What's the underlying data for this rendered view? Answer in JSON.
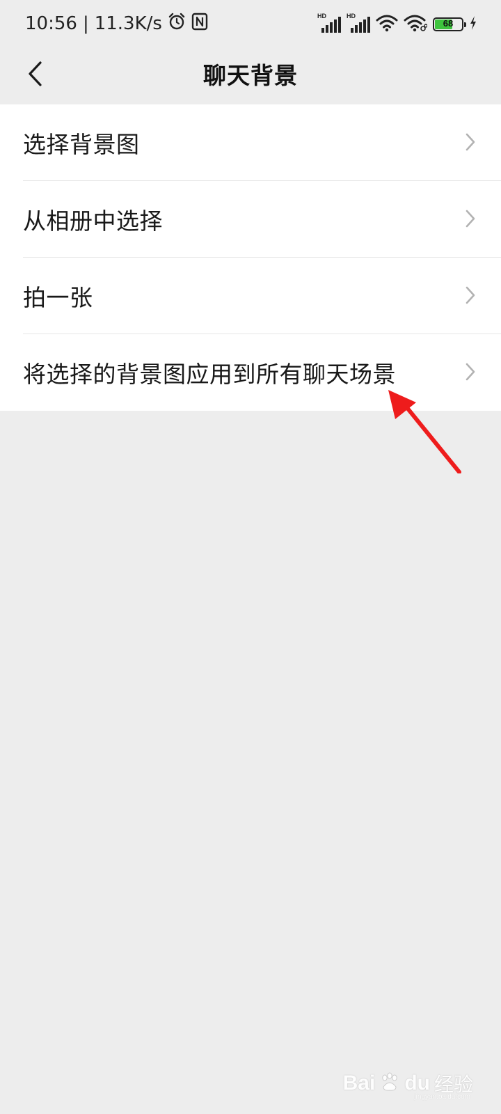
{
  "status_bar": {
    "time": "10:56",
    "separator": "|",
    "net_speed": "11.3K/s",
    "icons": [
      "alarm-icon",
      "nfc-icon",
      "signal-hd-icon",
      "signal-hd-icon",
      "wifi-icon",
      "wifi-link-icon",
      "battery-icon",
      "charging-icon"
    ],
    "hd_label_1": "HD",
    "hd_label_2": "HD",
    "battery_level": 68,
    "battery_text": "68",
    "battery_color": "#3ec43e"
  },
  "nav": {
    "title": "聊天背景",
    "back_icon": "chevron-left-icon"
  },
  "list": {
    "items": [
      {
        "label": "选择背景图"
      },
      {
        "label": "从相册中选择"
      },
      {
        "label": "拍一张"
      },
      {
        "label": "将选择的背景图应用到所有聊天场景"
      }
    ],
    "chevron_icon": "chevron-right-icon"
  },
  "annotation": {
    "arrow_icon": "red-arrow-icon",
    "arrow_color": "#ee1c1c"
  },
  "watermark": {
    "brand": "Bai",
    "brand2": "du",
    "sub": "经验",
    "url": "jingyan.baidu.com"
  },
  "colors": {
    "background": "#ededed",
    "list_background": "#ffffff",
    "divider": "#e6e6e6",
    "chevron": "#b2b2b2"
  }
}
